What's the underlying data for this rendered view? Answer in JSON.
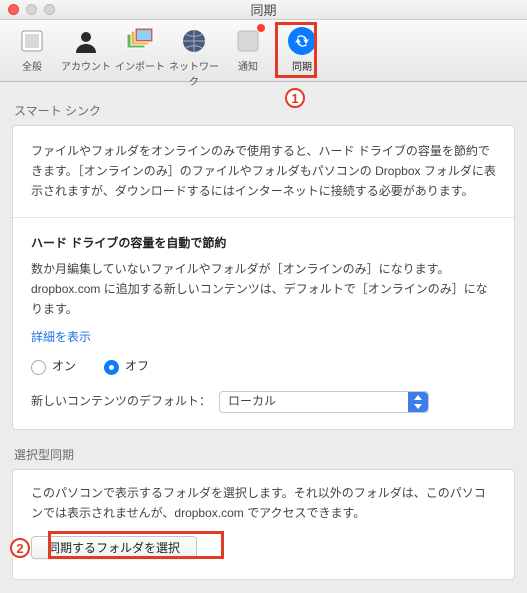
{
  "window": {
    "title": "同期"
  },
  "toolbar": {
    "general": "全般",
    "account": "アカウント",
    "import": "インポート",
    "network": "ネットワーク",
    "notify": "通知",
    "sync": "同期"
  },
  "annot": {
    "n1": "1",
    "n2": "2"
  },
  "smart": {
    "heading": "スマート シンク",
    "desc": "ファイルやフォルダをオンラインのみで使用すると、ハード ドライブの容量を節約できます。［オンラインのみ］のファイルやフォルダもパソコンの Dropbox フォルダに表示されますが、ダウンロードするにはインターネットに接続する必要があります。",
    "autoHeading": "ハード ドライブの容量を自動で節約",
    "autoDesc": "数か月編集していないファイルやフォルダが［オンラインのみ］になります。dropbox.com に追加する新しいコンテンツは、デフォルトで［オンラインのみ］になります。",
    "detailsLink": "詳細を表示",
    "radioOn": "オン",
    "radioOff": "オフ",
    "defaultLabel": "新しいコンテンツのデフォルト：",
    "defaultValue": "ローカル"
  },
  "selective": {
    "heading": "選択型同期",
    "desc": "このパソコンで表示するフォルダを選択します。それ以外のフォルダは、このパソコンでは表示されませんが、dropbox.com でアクセスできます。",
    "button": "同期するフォルダを選択"
  }
}
